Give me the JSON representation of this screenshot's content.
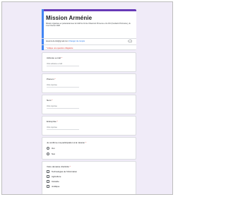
{
  "form": {
    "title": "Mission Arménie",
    "description": "Mission organisée en partenariat avec la CoMi du Cd de Chaumont Provence et la CIU (Fundació D'Arménie), du 2 au 6 février 2026",
    "account_email": "lesamis.de.lolo@gmail.com",
    "switch_account": "Changer de compte",
    "required_note": "* Indique une question obligatoire"
  },
  "questions": {
    "email": {
      "label": "Adresse e-mail",
      "placeholder": "Votre adresse e-mail"
    },
    "prenom": {
      "label": "Prénom",
      "placeholder": "Votre réponse"
    },
    "nom": {
      "label": "Nom",
      "placeholder": "Votre réponse"
    },
    "entreprise": {
      "label": "Entreprise",
      "placeholder": "Votre réponse"
    },
    "participation": {
      "label": "Je confirme ma participation à la mission",
      "options": [
        "Oui",
        "Non"
      ]
    },
    "domaine": {
      "label": "Votre domaine d'activité",
      "options": [
        "Technologies de l'information",
        "Agriculture",
        "Industrie",
        "Juridique"
      ]
    }
  },
  "required_star": "*",
  "icons": {
    "account": "cloud-icon"
  }
}
